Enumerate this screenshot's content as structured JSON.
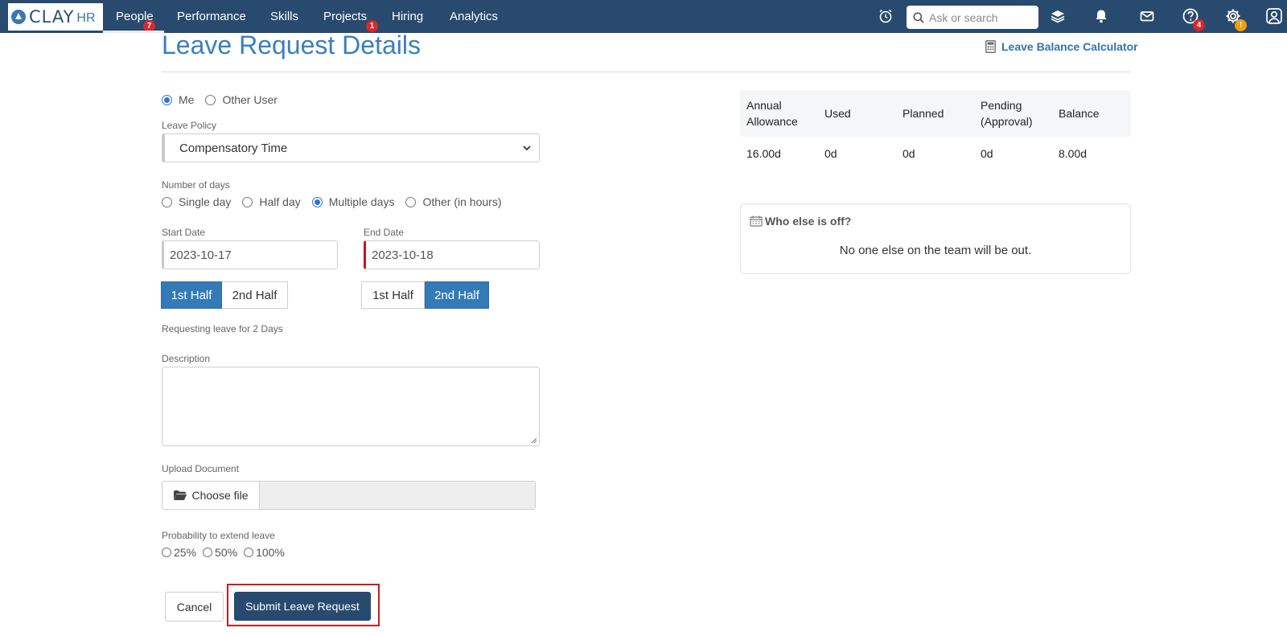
{
  "nav": {
    "logo_text": "CLAY",
    "logo_suffix": "HR",
    "items": [
      {
        "label": "People",
        "badge": "7"
      },
      {
        "label": "Performance"
      },
      {
        "label": "Skills"
      },
      {
        "label": "Projects",
        "badge": "1"
      },
      {
        "label": "Hiring"
      },
      {
        "label": "Analytics"
      }
    ],
    "search_placeholder": "Ask or search",
    "help_badge": "4",
    "settings_badge": "!",
    "icons": [
      "alarm-clock-icon",
      "layers-icon",
      "bell-icon",
      "envelope-icon",
      "help-icon",
      "gear-icon",
      "user-icon"
    ]
  },
  "header": {
    "title": "Leave Request Details",
    "calc_link": "Leave Balance Calculator"
  },
  "form": {
    "user_options": [
      {
        "label": "Me",
        "checked": true
      },
      {
        "label": "Other User",
        "checked": false
      }
    ],
    "leave_policy_label": "Leave Policy",
    "leave_policy_value": "Compensatory Time",
    "days_label": "Number of days",
    "days_options": [
      {
        "label": "Single day",
        "checked": false
      },
      {
        "label": "Half day",
        "checked": false
      },
      {
        "label": "Multiple days",
        "checked": true
      },
      {
        "label": "Other (in hours)",
        "checked": false
      }
    ],
    "start_label": "Start Date",
    "start_value": "2023-10-17",
    "end_label": "End Date",
    "end_value": "2023-10-18",
    "start_halves": [
      {
        "label": "1st Half",
        "active": true
      },
      {
        "label": "2nd Half",
        "active": false
      }
    ],
    "end_halves": [
      {
        "label": "1st Half",
        "active": false
      },
      {
        "label": "2nd Half",
        "active": true
      }
    ],
    "requesting_text": "Requesting leave for 2 Days",
    "description_label": "Description",
    "description_value": "",
    "upload_label": "Upload Document",
    "choose_file": "Choose file",
    "probability_label": "Probability to extend leave",
    "probability_options": [
      "25%",
      "50%",
      "100%"
    ],
    "cancel_label": "Cancel",
    "submit_label": "Submit Leave Request"
  },
  "balance": {
    "headers": [
      "Annual Allowance",
      "Used",
      "Planned",
      "Pending (Approval)",
      "Balance"
    ],
    "values": [
      "16.00d",
      "0d",
      "0d",
      "0d",
      "8.00d"
    ]
  },
  "who_off": {
    "title": "Who else is off?",
    "message": "No one else on the team will be out."
  },
  "colors": {
    "nav_bg": "#284a6e",
    "accent": "#337ab7",
    "title": "#3a7fbf",
    "highlight_border": "#d11a1a"
  }
}
